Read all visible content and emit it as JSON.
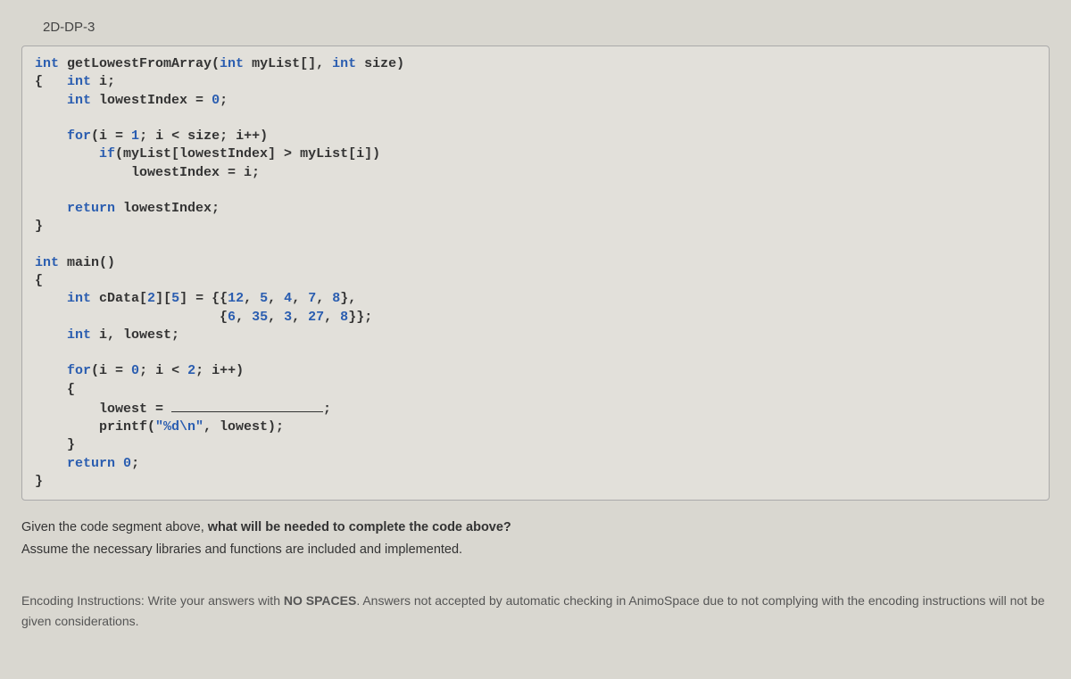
{
  "title": "2D-DP-3",
  "code": {
    "l1a": "int",
    "l1b": " getLowestFromArray(",
    "l1c": "int",
    "l1d": " myList[], ",
    "l1e": "int",
    "l1f": " size)",
    "l2a": "{   ",
    "l2b": "int",
    "l2c": " i;",
    "l3a": "    ",
    "l3b": "int",
    "l3c": " lowestIndex = ",
    "l3d": "0",
    "l3e": ";",
    "l4": " ",
    "l5a": "    ",
    "l5b": "for",
    "l5c": "(i = ",
    "l5d": "1",
    "l5e": "; i < size; i++)",
    "l6a": "        ",
    "l6b": "if",
    "l6c": "(myList[lowestIndex] > myList[i])",
    "l7": "            lowestIndex = i;",
    "l8": " ",
    "l9a": "    ",
    "l9b": "return",
    "l9c": " lowestIndex;",
    "l10": "}",
    "l11": " ",
    "l12a": "int",
    "l12b": " main()",
    "l13": "{",
    "l14a": "    ",
    "l14b": "int",
    "l14c": " cData[",
    "l14d": "2",
    "l14e": "][",
    "l14f": "5",
    "l14g": "] = {{",
    "l14h": "12",
    "l14i": ", ",
    "l14j": "5",
    "l14k": ", ",
    "l14l": "4",
    "l14m": ", ",
    "l14n": "7",
    "l14o": ", ",
    "l14p": "8",
    "l14q": "},",
    "l15a": "                       {",
    "l15b": "6",
    "l15c": ", ",
    "l15d": "35",
    "l15e": ", ",
    "l15f": "3",
    "l15g": ", ",
    "l15h": "27",
    "l15i": ", ",
    "l15j": "8",
    "l15k": "}};",
    "l16a": "    ",
    "l16b": "int",
    "l16c": " i, lowest;",
    "l17": " ",
    "l18a": "    ",
    "l18b": "for",
    "l18c": "(i = ",
    "l18d": "0",
    "l18e": "; i < ",
    "l18f": "2",
    "l18g": "; i++)",
    "l19": "    {",
    "l20a": "        lowest = ",
    "l20b": ";",
    "l21a": "        printf(",
    "l21b": "\"%d\\n\"",
    "l21c": ", lowest);",
    "l22": "    }",
    "l23a": "    ",
    "l23b": "return",
    "l23c": " ",
    "l23d": "0",
    "l23e": ";",
    "l24": "}"
  },
  "question": {
    "q1a": "Given the code segment above, ",
    "q1b": "what will be needed to complete the code above?",
    "q2": "Assume the necessary libraries and functions are included and implemented."
  },
  "instructions": {
    "label": "Encoding Instructions: ",
    "t1": "Write your answers with ",
    "t2": "NO SPACES",
    "t3": ". Answers not accepted by automatic checking in AnimoSpace due to not complying with the encoding instructions will not be given considerations."
  }
}
